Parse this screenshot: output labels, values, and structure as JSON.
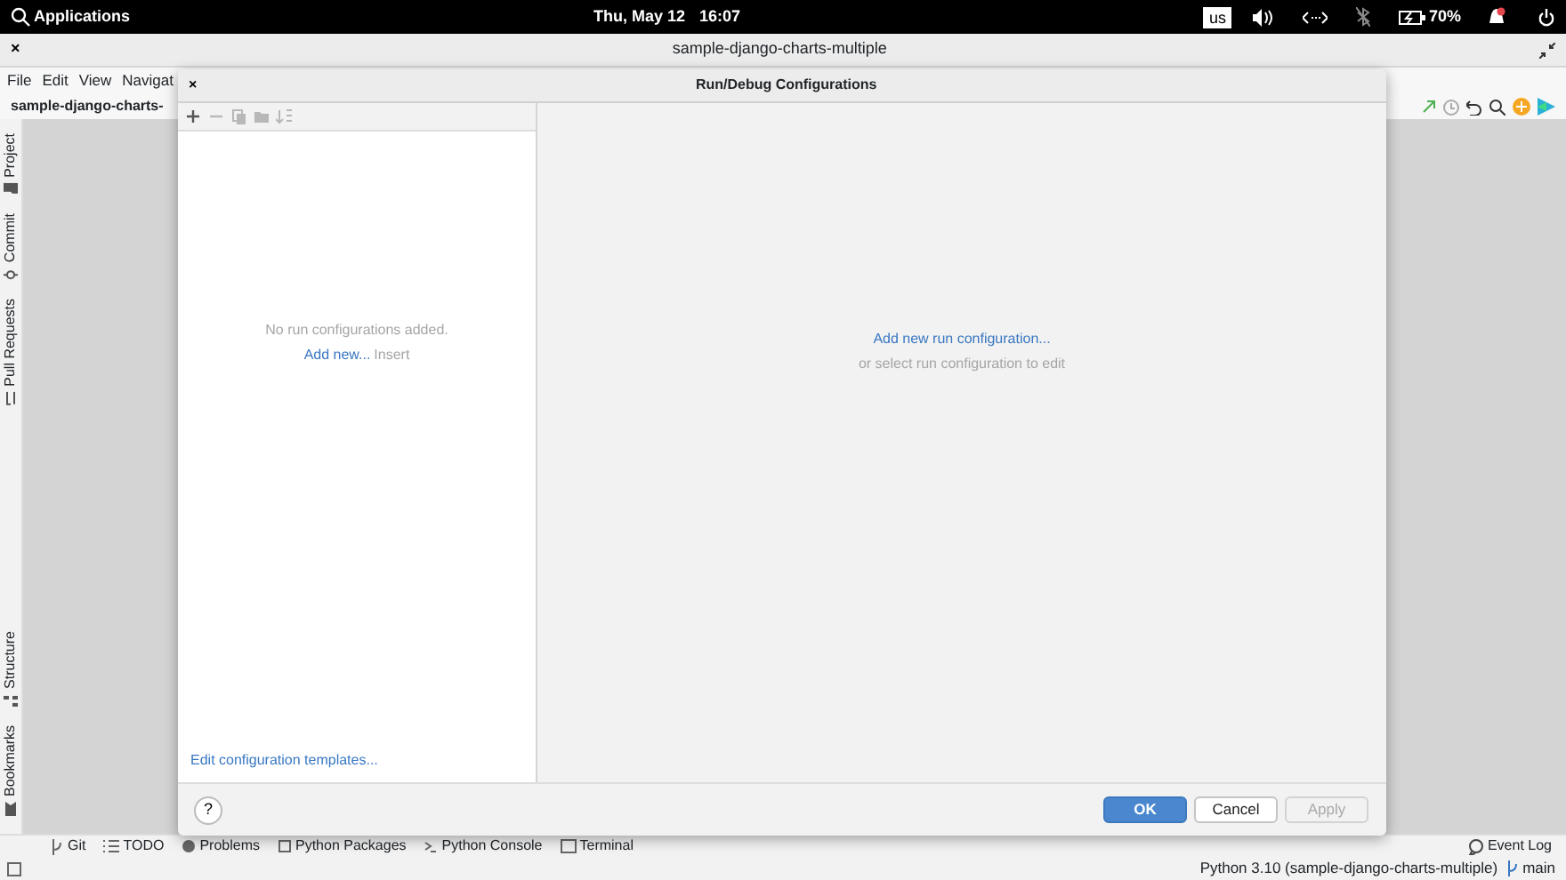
{
  "top_bar": {
    "applications": "Applications",
    "date": "Thu, May 12",
    "time": "16:07",
    "keyboard_layout": "us",
    "battery": "70%"
  },
  "ide": {
    "close": "×",
    "title": "sample-django-charts-multiple",
    "menu": [
      "File",
      "Edit",
      "View",
      "Navigat"
    ],
    "project_name": "sample-django-charts-",
    "left_tabs": [
      "Project",
      "Commit",
      "Pull Requests"
    ],
    "left_tabs_bottom": [
      "Structure",
      "Bookmarks"
    ],
    "bottom_tabs": [
      "Git",
      "TODO",
      "Problems",
      "Python Packages",
      "Python Console",
      "Terminal"
    ],
    "event_log": "Event Log",
    "status_bar": {
      "interpreter": "Python 3.10 (sample-django-charts-multiple)",
      "branch": "main"
    }
  },
  "dialog": {
    "close": "×",
    "title": "Run/Debug Configurations",
    "toolbar": [
      {
        "disabled": false
      },
      {
        "disabled": true
      },
      {
        "disabled": true
      },
      {
        "disabled": true
      },
      {
        "disabled": true
      }
    ],
    "empty_text": "No run configurations added.",
    "add_new_link": "Add new...",
    "add_new_shortcut": "Insert",
    "templates_link": "Edit configuration templates...",
    "right_link": "Add new run configuration...",
    "right_hint": "or select run configuration to edit",
    "help": "?",
    "buttons": [
      {
        "label": "OK",
        "kind": "primary",
        "disabled": false
      },
      {
        "label": "Cancel",
        "kind": "secondary",
        "disabled": false
      },
      {
        "label": "Apply",
        "kind": "secondary",
        "disabled": true
      }
    ]
  }
}
